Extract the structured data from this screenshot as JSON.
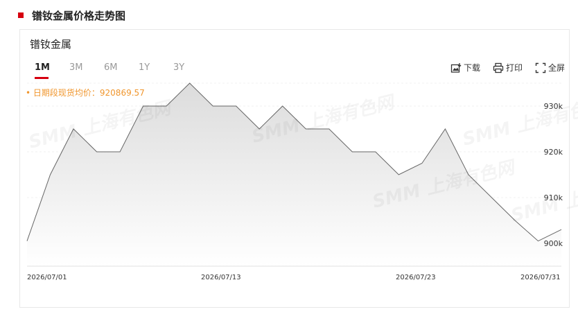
{
  "header": {
    "title": "镨钕金属价格走势图"
  },
  "card": {
    "metal_name": "镨钕金属",
    "tabs": [
      {
        "label": "1M",
        "active": true
      },
      {
        "label": "3M",
        "active": false
      },
      {
        "label": "6M",
        "active": false
      },
      {
        "label": "1Y",
        "active": false
      },
      {
        "label": "3Y",
        "active": false
      }
    ],
    "tools": {
      "download": "下载",
      "print": "打印",
      "fullscreen": "全屏"
    },
    "average_label": "日期段现货均价：920869.57",
    "watermark_text": "SMM 上海有色网"
  },
  "colors": {
    "accent": "#d6000f",
    "average": "#f0962d",
    "line": "#666666"
  },
  "chart_data": {
    "type": "area",
    "title": "",
    "xlabel": "",
    "ylabel": "",
    "x_tick_labels": [
      "2026/07/01",
      "2026/07/13",
      "2026/07/23",
      "2026/07/31"
    ],
    "y_tick_labels": [
      "900k",
      "910k",
      "920k",
      "930k"
    ],
    "y_ticks": [
      900000,
      910000,
      920000,
      930000
    ],
    "ylim": [
      895000,
      935000
    ],
    "grid": true,
    "x": [
      "2026/07/01",
      "2026/07/02",
      "2026/07/03",
      "2026/07/06",
      "2026/07/07",
      "2026/07/08",
      "2026/07/09",
      "2026/07/10",
      "2026/07/13",
      "2026/07/14",
      "2026/07/15",
      "2026/07/16",
      "2026/07/17",
      "2026/07/20",
      "2026/07/21",
      "2026/07/22",
      "2026/07/23",
      "2026/07/24",
      "2026/07/27",
      "2026/07/28",
      "2026/07/29",
      "2026/07/30",
      "2026/07/31",
      "2026/07/31b"
    ],
    "series": [
      {
        "name": "",
        "values": [
          {
            "date": "2026/07/01",
            "value": 900500
          },
          {
            "date": "2026/07/02",
            "value": 915000
          },
          {
            "date": "2026/07/03",
            "value": 925000
          },
          {
            "date": "2026/07/06",
            "value": 920000
          },
          {
            "date": "2026/07/07",
            "value": 920000
          },
          {
            "date": "2026/07/08",
            "value": 930000
          },
          {
            "date": "2026/07/09",
            "value": 930000
          },
          {
            "date": "2026/07/10",
            "value": 935000
          },
          {
            "date": "2026/07/13",
            "value": 930000
          },
          {
            "date": "2026/07/14",
            "value": 930000
          },
          {
            "date": "2026/07/15",
            "value": 925000
          },
          {
            "date": "2026/07/16",
            "value": 930000
          },
          {
            "date": "2026/07/17",
            "value": 925000
          },
          {
            "date": "2026/07/20",
            "value": 925000
          },
          {
            "date": "2026/07/21",
            "value": 920000
          },
          {
            "date": "2026/07/22",
            "value": 920000
          },
          {
            "date": "2026/07/23",
            "value": 915000
          },
          {
            "date": "2026/07/24",
            "value": 917500
          },
          {
            "date": "2026/07/27",
            "value": 925000
          },
          {
            "date": "2026/07/28",
            "value": 915000
          },
          {
            "date": "2026/07/29",
            "value": 910000
          },
          {
            "date": "2026/07/30",
            "value": 905000
          },
          {
            "date": "2026/07/31",
            "value": 900500
          },
          {
            "date": "2026/07/31",
            "value": 903000
          }
        ]
      }
    ]
  }
}
